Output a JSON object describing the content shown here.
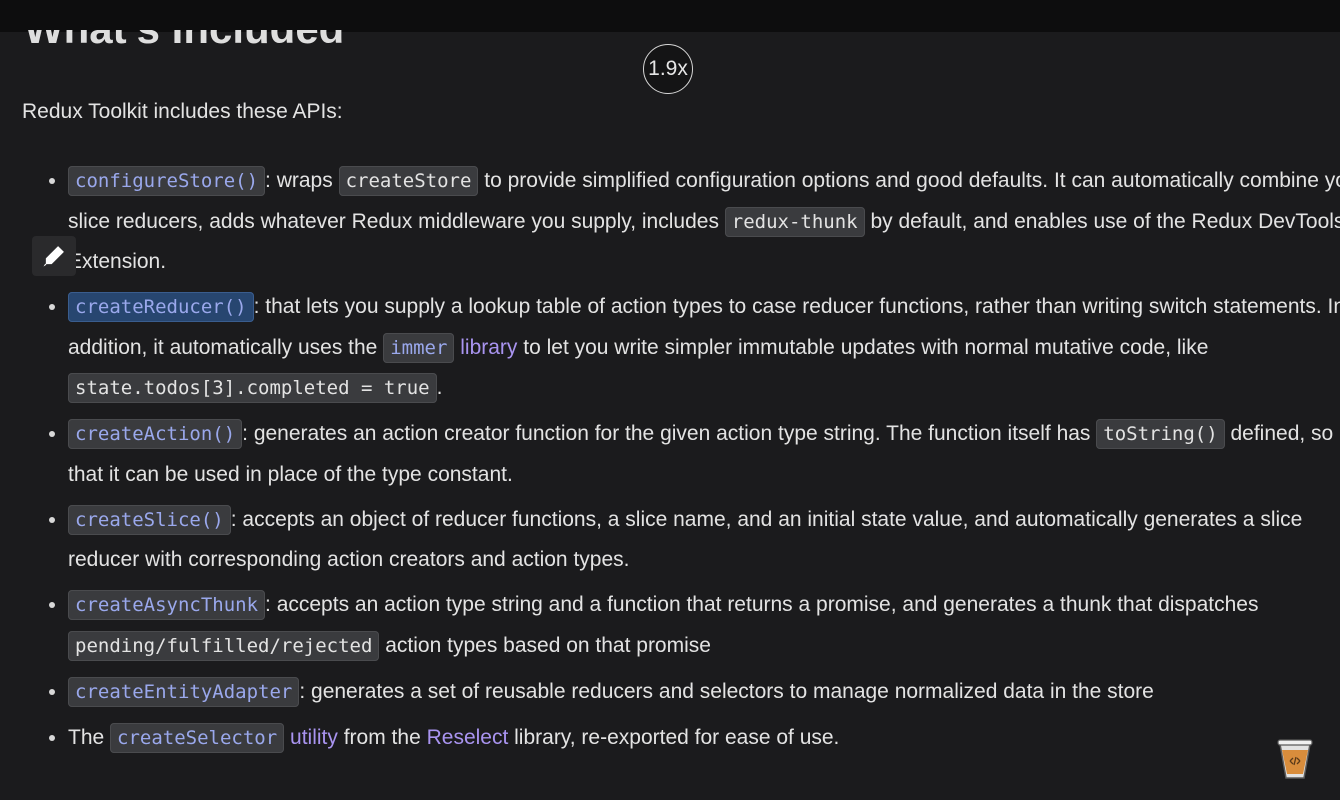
{
  "heading": "What's Included",
  "speed_badge": "1.9x",
  "intro": "Redux Toolkit includes these APIs:",
  "items": [
    {
      "code": "configureStore()",
      "t1": ": wraps ",
      "c2": "createStore",
      "t2": " to provide simplified configuration options and good defaults. It can automatically combine your slice reducers, adds whatever Redux middleware you supply, includes ",
      "c3": "redux-thunk",
      "t3": " by default, and enables use of the Redux DevTools Extension."
    },
    {
      "code": "createReducer()",
      "t1": ": that lets you supply a lookup table of action types to case reducer functions, rather than writing switch statements. In addition, it automatically uses the ",
      "c2": "immer",
      "link": "library",
      "t2": " to let you write simpler immutable updates with normal mutative code, like ",
      "c3": "state.todos[3].completed = true",
      "t3": "."
    },
    {
      "code": "createAction()",
      "t1": ": generates an action creator function for the given action type string. The function itself has ",
      "c2": "toString()",
      "t2": " defined, so that it can be used in place of the type constant."
    },
    {
      "code": "createSlice()",
      "t1": ": accepts an object of reducer functions, a slice name, and an initial state value, and automatically generates a slice reducer with corresponding action creators and action types."
    },
    {
      "code": "createAsyncThunk",
      "t1": ": accepts an action type string and a function that returns a promise, and generates a thunk that dispatches ",
      "c2": "pending/fulfilled/rejected",
      "t2": " action types based on that promise"
    },
    {
      "code": "createEntityAdapter",
      "t1": ": generates a set of reusable reducers and selectors to manage normalized data in the store"
    },
    {
      "t0": "The ",
      "code": "createSelector",
      "link": "utility",
      "t1": " from the ",
      "link2": "Reselect",
      "t2": " library, re-exported for ease of use."
    }
  ],
  "icons": {
    "pen": "pen-icon",
    "cup": "coffee-cup-icon"
  },
  "colors": {
    "background": "#1b1b1d",
    "link": "#a994f0",
    "code_bg": "#3a3b3e",
    "highlight": "#274670"
  }
}
